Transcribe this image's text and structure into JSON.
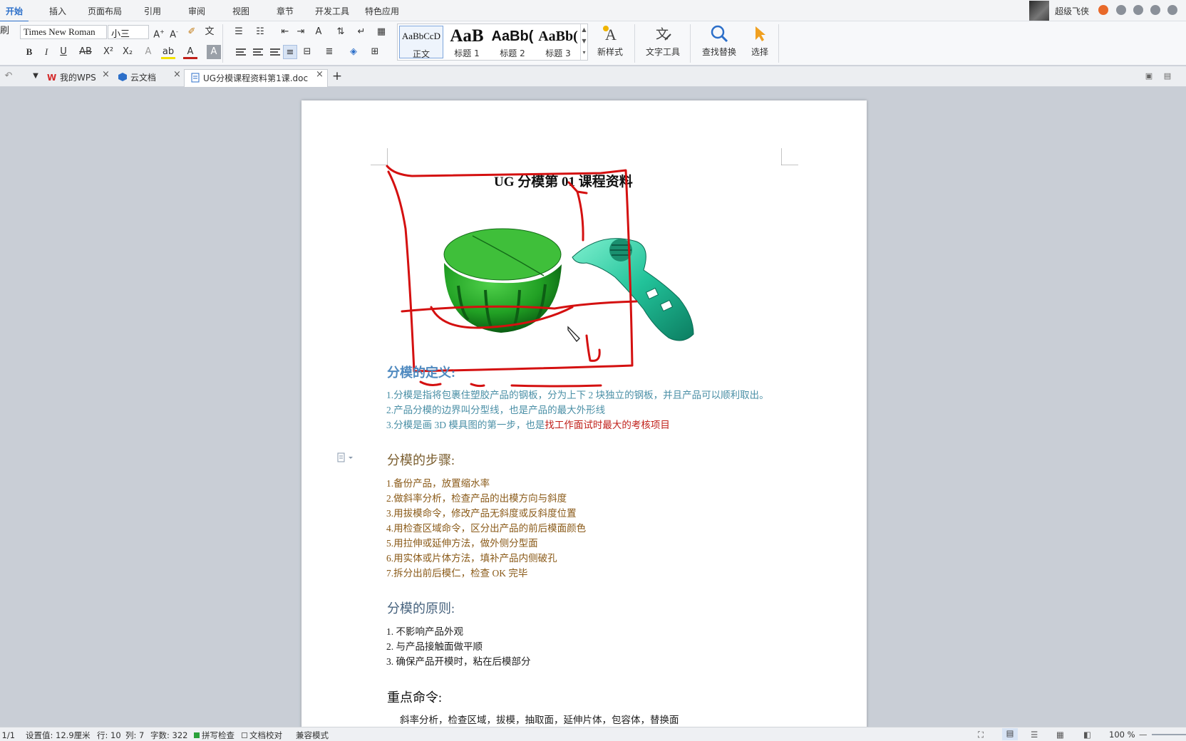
{
  "menubar": {
    "tabs": [
      "开始",
      "插入",
      "页面布局",
      "引用",
      "审阅",
      "视图",
      "章节",
      "开发工具",
      "特色应用"
    ],
    "active_tab": "开始",
    "user_name": "超级飞侠"
  },
  "toolbar": {
    "font_family": "Times New Roman",
    "font_size": "小三",
    "styles": [
      {
        "preview": "AaBbCcD",
        "name": "正文"
      },
      {
        "preview": "AaB",
        "name": "标题 1"
      },
      {
        "preview": "AaBb(",
        "name": "标题 2"
      },
      {
        "preview": "AaBb(",
        "name": "标题 3"
      }
    ],
    "new_style_label": "新样式",
    "text_tools_label": "文字工具",
    "find_replace_label": "查找替换",
    "select_label": "选择"
  },
  "tabs": [
    {
      "label": "我的WPS"
    },
    {
      "label": "云文档"
    },
    {
      "label": "UG分模课程资料第1课.doc"
    }
  ],
  "document": {
    "title": "UG 分模第 01 课程资料",
    "definition": {
      "heading": "分模的定义:",
      "lines": [
        "1.分模是指将包裹住塑胶产品的钢板，分为上下 2 块独立的钢板，并且产品可以顺利取出。",
        "2.产品分模的边界叫分型线，也是产品的最大外形线"
      ],
      "line3_prefix": "3.分模是画 3D 模具图的第一步，也是",
      "line3_highlight": "找工作面试时最大的考核项目"
    },
    "steps": {
      "heading": "分模的步骤:",
      "lines": [
        "1.备份产品，放置缩水率",
        "2.做斜率分析，检查产品的出模方向与斜度",
        "3.用拔模命令，修改产品无斜度或反斜度位置",
        "4.用检查区域命令，区分出产品的前后模面颜色",
        "5.用拉伸或延伸方法，做外侧分型面",
        "6.用实体或片体方法，填补产品内侧破孔",
        "7.拆分出前后模仁，检查 OK 完毕"
      ]
    },
    "principles": {
      "heading": "分模的原则:",
      "lines": [
        "1.   不影响产品外观",
        "2.   与产品接触面做平顺",
        "3.   确保产品开模时，粘在后模部分"
      ]
    },
    "commands": {
      "heading": "重点命令:",
      "line": "斜率分析，检查区域，拔模，抽取面，延伸片体，包容体，替换面"
    }
  },
  "statusbar": {
    "page": "页码: 1/1",
    "setting": "设置值: 12.9厘米",
    "row": "行: 10",
    "col": "列: 7",
    "words": "字数: 322",
    "spell": "拼写检查",
    "proof": "文档校对",
    "compat": "兼容模式",
    "zoom": "100 %"
  }
}
